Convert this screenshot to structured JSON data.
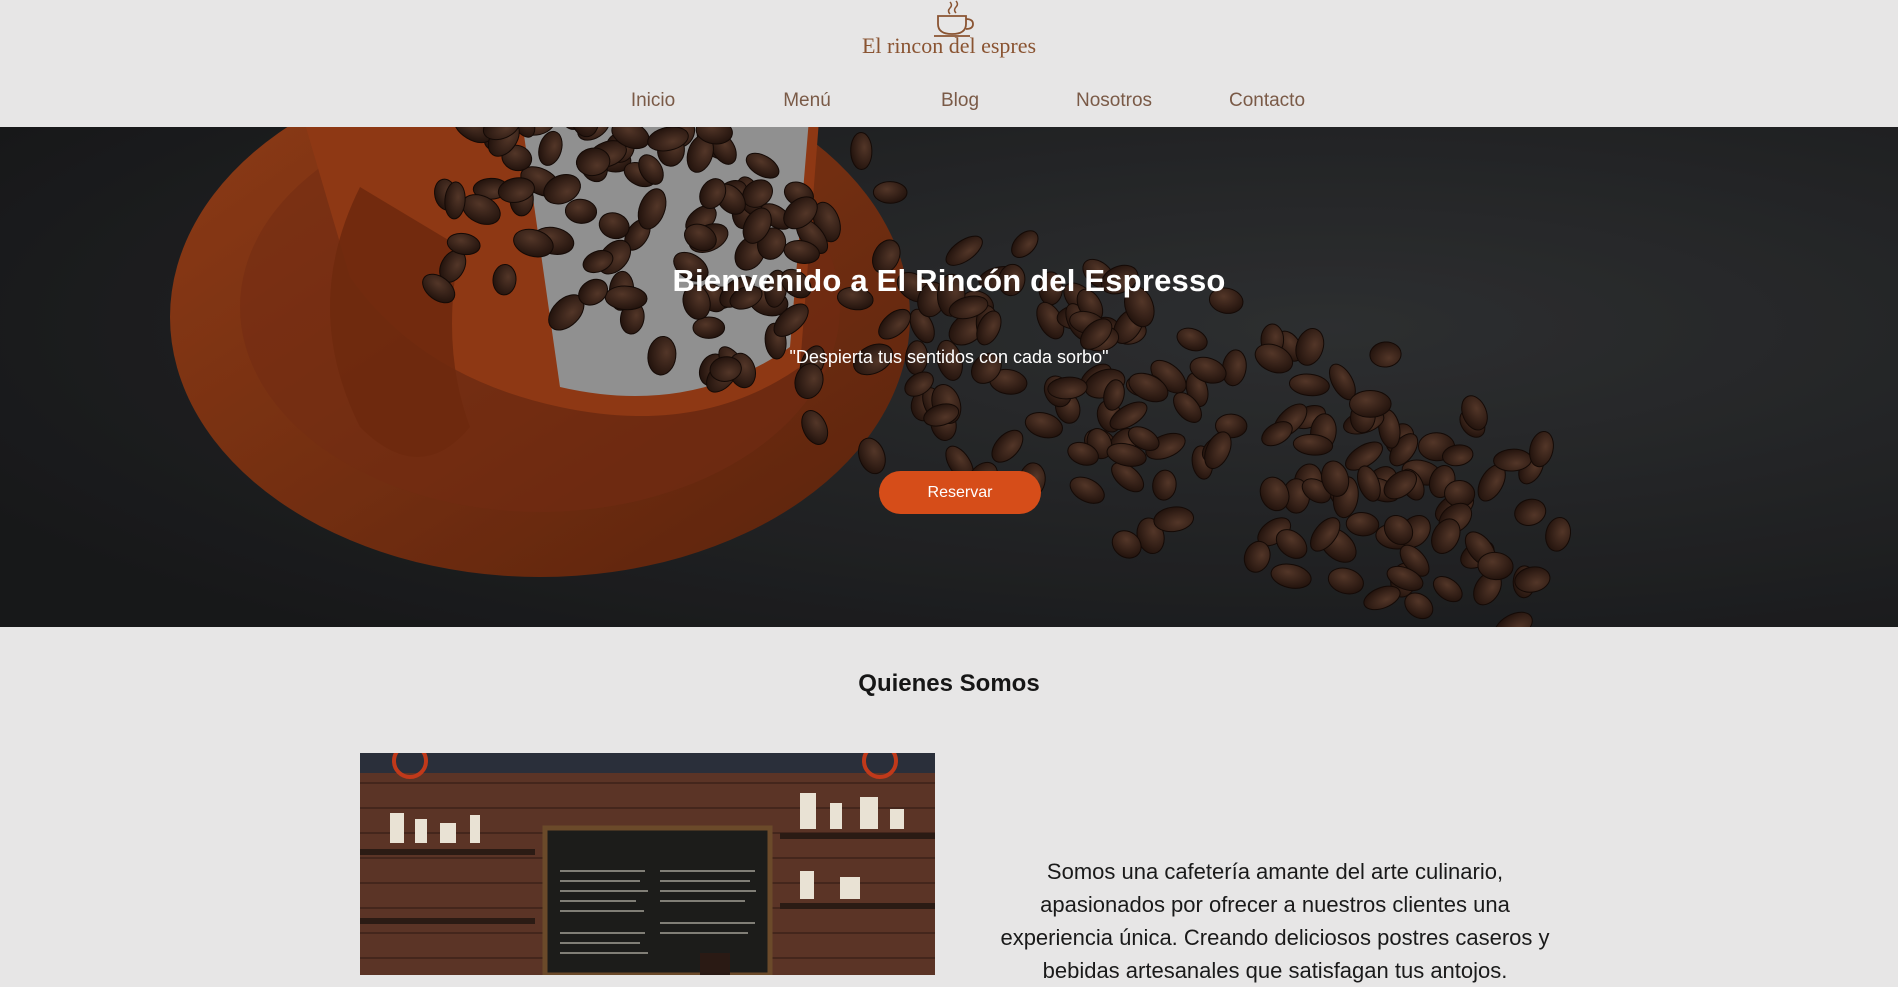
{
  "header": {
    "brand": "El rincon del espres",
    "logo_icon": "coffee-cup-icon",
    "nav": [
      {
        "label": "Inicio"
      },
      {
        "label": "Menú"
      },
      {
        "label": "Blog"
      },
      {
        "label": "Nosotros"
      },
      {
        "label": "Contacto"
      }
    ]
  },
  "hero": {
    "title": "Bienvenido a El Rincón del Espresso",
    "tagline": "\"Despierta tus sentidos con cada sorbo\"",
    "cta_label": "Reservar"
  },
  "about": {
    "title": "Quienes Somos",
    "text": "Somos una cafetería amante del arte culinario, apasionados por ofrecer a nuestros clientes una experiencia única. Creando deliciosos postres caseros y bebidas artesanales que satisfagan tus antojos."
  },
  "colors": {
    "background": "#e7e6e6",
    "brand": "#8a5432",
    "nav_text": "#7a5a47",
    "accent": "#d64d19"
  }
}
